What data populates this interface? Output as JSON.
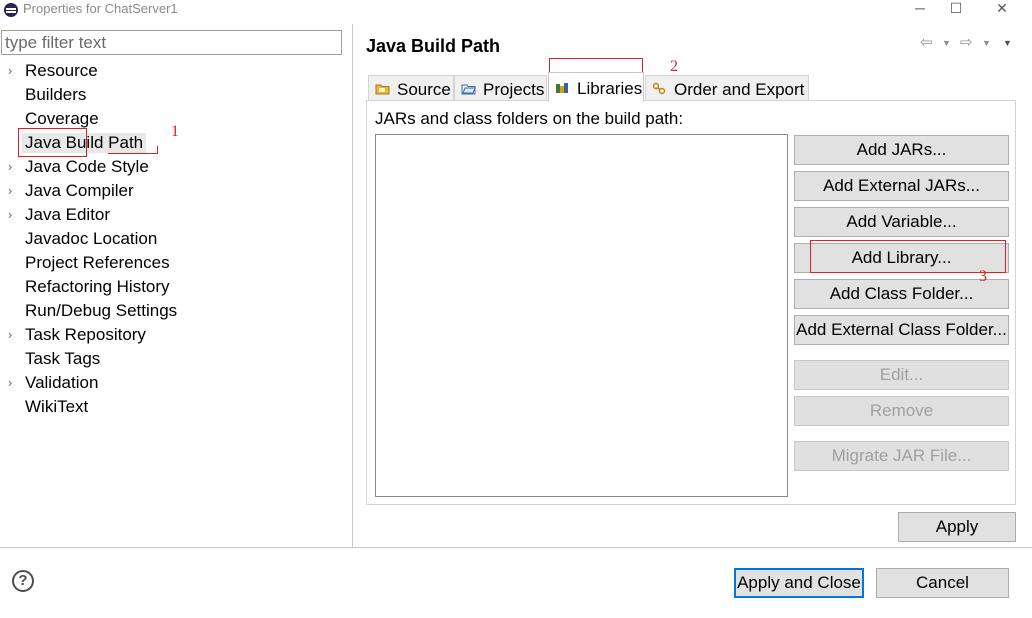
{
  "window": {
    "title": "Properties for ChatServer1",
    "controls": {
      "minimize": "─",
      "maximize": "☐",
      "close": "✕"
    }
  },
  "filter": {
    "placeholder": "type filter text",
    "value": ""
  },
  "tree": {
    "items": [
      {
        "label": "Resource",
        "expandable": true
      },
      {
        "label": "Builders",
        "expandable": false
      },
      {
        "label": "Coverage",
        "expandable": false
      },
      {
        "label": "Java Build Path",
        "expandable": false,
        "selected": true
      },
      {
        "label": "Java Code Style",
        "expandable": true
      },
      {
        "label": "Java Compiler",
        "expandable": true
      },
      {
        "label": "Java Editor",
        "expandable": true
      },
      {
        "label": "Javadoc Location",
        "expandable": false
      },
      {
        "label": "Project References",
        "expandable": false
      },
      {
        "label": "Refactoring History",
        "expandable": false
      },
      {
        "label": "Run/Debug Settings",
        "expandable": false
      },
      {
        "label": "Task Repository",
        "expandable": true
      },
      {
        "label": "Task Tags",
        "expandable": false
      },
      {
        "label": "Validation",
        "expandable": true
      },
      {
        "label": "WikiText",
        "expandable": false
      }
    ],
    "chevron": "›"
  },
  "page": {
    "title": "Java Build Path",
    "nav": {
      "back": "⇦",
      "forward": "⇨",
      "dropdown": "▼"
    }
  },
  "tabs": {
    "items": [
      {
        "label": "Source",
        "icon": "source-folder-icon"
      },
      {
        "label": "Projects",
        "icon": "projects-folder-icon"
      },
      {
        "label": "Libraries",
        "icon": "libraries-icon",
        "active": true
      },
      {
        "label": "Order and Export",
        "icon": "order-export-icon"
      }
    ]
  },
  "libraries": {
    "description": "JARs and class folders on the build path:",
    "entries": [],
    "buttons": {
      "add_jars": "Add JARs...",
      "add_external_jars": "Add External JARs...",
      "add_variable": "Add Variable...",
      "add_library": "Add Library...",
      "add_class_folder": "Add Class Folder...",
      "add_external_class_folder": "Add External Class Folder...",
      "edit": "Edit...",
      "remove": "Remove",
      "migrate_jar": "Migrate JAR File..."
    }
  },
  "footer": {
    "apply": "Apply",
    "apply_and_close": "Apply and Close",
    "cancel": "Cancel",
    "help": "?"
  },
  "annotations": {
    "one": "1",
    "two": "2",
    "three": "3",
    "color": "#e02020"
  }
}
